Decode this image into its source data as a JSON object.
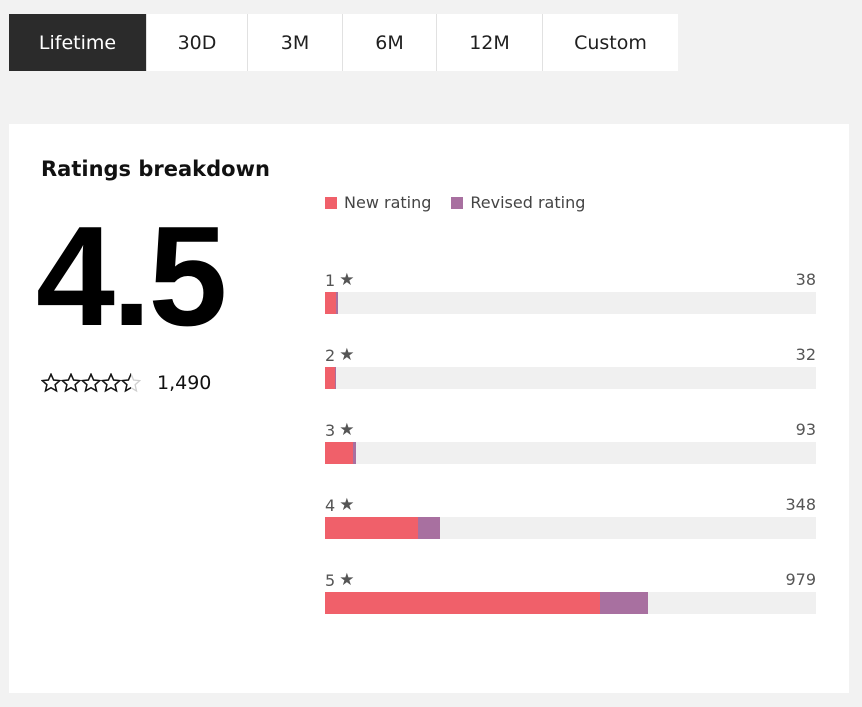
{
  "tabs": [
    {
      "label": "Lifetime",
      "active": true
    },
    {
      "label": "30D",
      "active": false
    },
    {
      "label": "3M",
      "active": false
    },
    {
      "label": "6M",
      "active": false
    },
    {
      "label": "12M",
      "active": false
    },
    {
      "label": "Custom",
      "active": false
    }
  ],
  "card": {
    "title": "Ratings breakdown",
    "average": "4.5",
    "total_ratings": "1,490",
    "stars_filled": 4.5
  },
  "colors": {
    "new_rating": "#f0606a",
    "revised_rating": "#a870a0",
    "track": "#f0f0f0",
    "active_tab": "#2b2b2b"
  },
  "chart_data": {
    "type": "bar",
    "orientation": "horizontal",
    "stacked": true,
    "title": "Ratings breakdown",
    "categories": [
      "1",
      "2",
      "3",
      "4",
      "5"
    ],
    "category_suffix": "★",
    "totals": [
      38,
      32,
      93,
      348,
      979
    ],
    "xlim": [
      0,
      1490
    ],
    "series": [
      {
        "name": "New rating",
        "values": [
          34,
          30,
          86,
          283,
          836
        ]
      },
      {
        "name": "Revised rating",
        "values": [
          4,
          2,
          7,
          65,
          143
        ]
      }
    ],
    "legend": "top-left"
  }
}
